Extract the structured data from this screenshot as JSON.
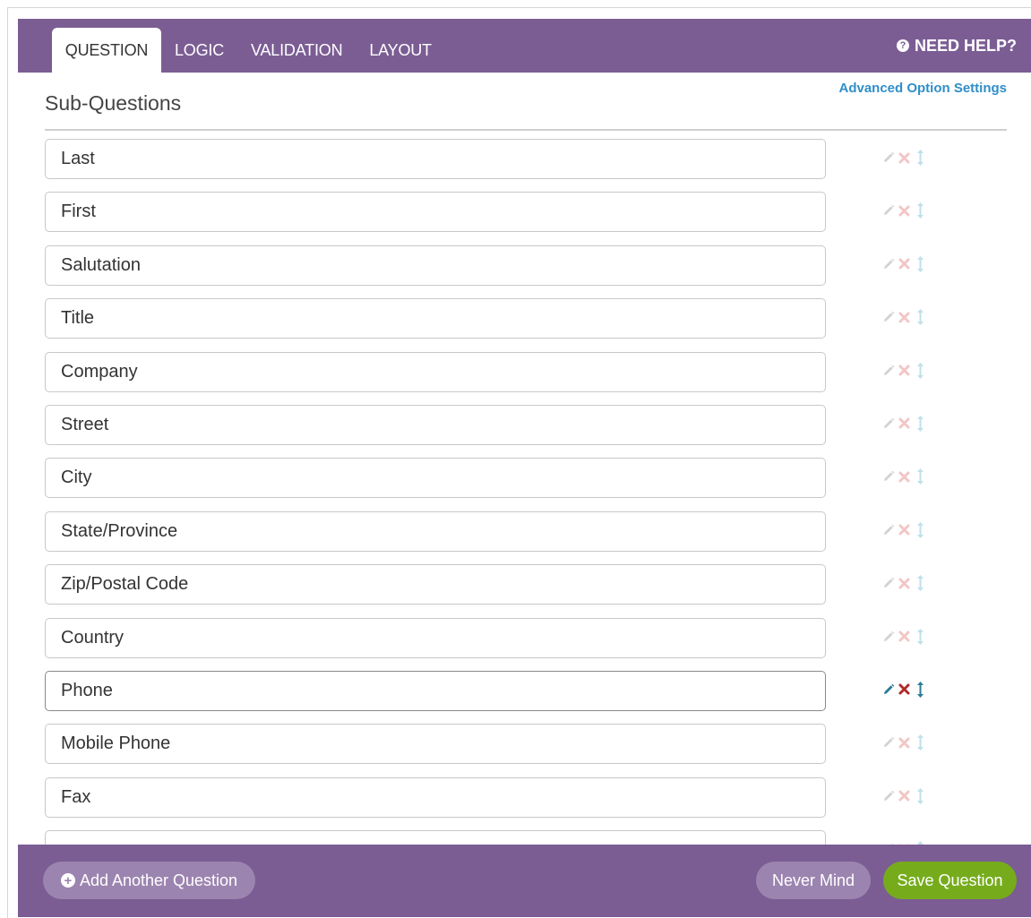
{
  "tabs": [
    {
      "label": "QUESTION",
      "active": true
    },
    {
      "label": "LOGIC",
      "active": false
    },
    {
      "label": "VALIDATION",
      "active": false
    },
    {
      "label": "LAYOUT",
      "active": false
    }
  ],
  "help": {
    "label": "NEED HELP?",
    "icon": "question-circle-icon"
  },
  "section": {
    "title": "Sub-Questions",
    "advanced_link": "Advanced Option Settings"
  },
  "sub_questions": [
    {
      "value": "Last",
      "highlighted": false
    },
    {
      "value": "First",
      "highlighted": false
    },
    {
      "value": "Salutation",
      "highlighted": false
    },
    {
      "value": "Title",
      "highlighted": false
    },
    {
      "value": "Company",
      "highlighted": false
    },
    {
      "value": "Street",
      "highlighted": false
    },
    {
      "value": "City",
      "highlighted": false
    },
    {
      "value": "State/Province",
      "highlighted": false
    },
    {
      "value": "Zip/Postal Code",
      "highlighted": false
    },
    {
      "value": "Country",
      "highlighted": false
    },
    {
      "value": "Phone",
      "highlighted": true
    },
    {
      "value": "Mobile Phone",
      "highlighted": false
    },
    {
      "value": "Fax",
      "highlighted": false
    },
    {
      "value": "",
      "highlighted": false
    }
  ],
  "row_actions": {
    "icons": [
      "pencil-icon",
      "delete-x-icon",
      "reorder-arrows-icon"
    ],
    "colors_inactive": {
      "edit": "#d2d2d2",
      "delete": "#f2c6c6",
      "move": "#bfe0ea"
    },
    "colors_active": {
      "edit": "#2a7a94",
      "delete": "#b02a2a",
      "move": "#2a7a94"
    }
  },
  "footer": {
    "add_label": "Add Another Question",
    "cancel_label": "Never Mind",
    "save_label": "Save Question"
  },
  "colors": {
    "brand_purple": "#7b5d94",
    "button_purple": "#9c84b0",
    "save_green": "#76ac1c",
    "link_blue": "#2f8ec9"
  }
}
